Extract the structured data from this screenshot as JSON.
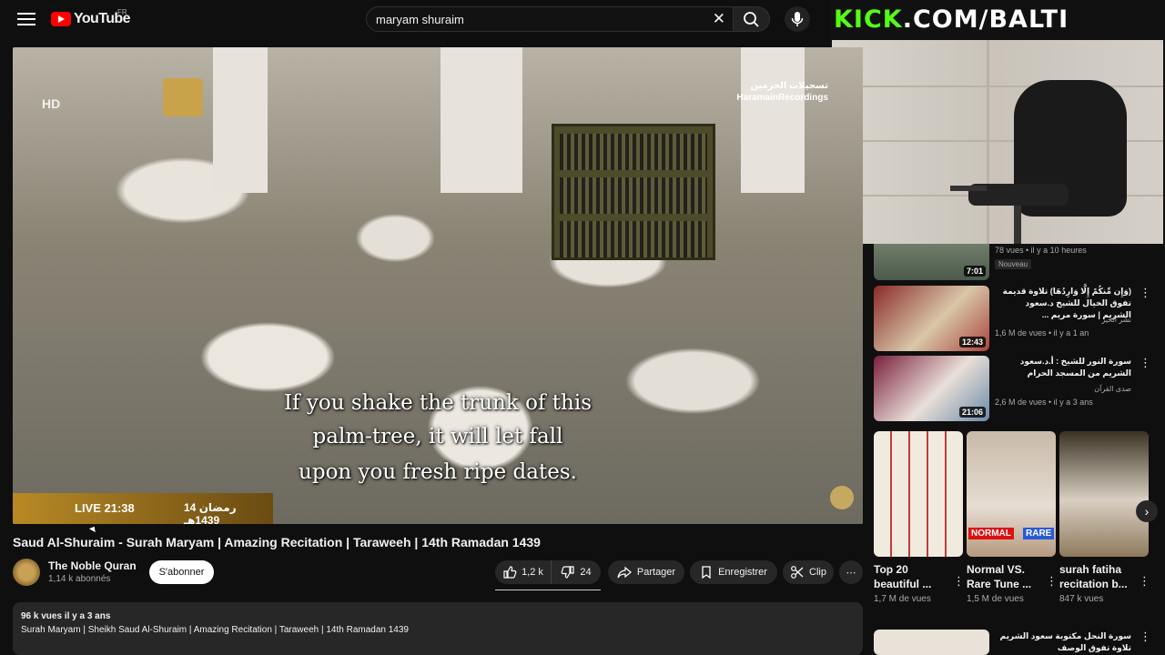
{
  "header": {
    "logo_text": "YouTube",
    "logo_region": "FR",
    "search_value": "maryam shuraim",
    "search_clear": "✕"
  },
  "overlay": {
    "kick_prefix": "KICK",
    "kick_suffix": ".COM/BALTI"
  },
  "video": {
    "channel_mark": "HD",
    "watermark_ar": "تسجيلات الحرمين",
    "watermark_en": "HaramainRecordings",
    "subtitle_lines": [
      "If you shake the trunk of this",
      "palm-tree, it will let fall",
      "upon you fresh ripe dates."
    ],
    "live_label": "LIVE 21:38",
    "live_date": "14 رمضان 1439هـ"
  },
  "watch": {
    "title": "Saud Al-Shuraim - Surah Maryam | Amazing Recitation | Taraweeh | 14th Ramadan 1439",
    "channel_name": "The Noble Quran",
    "subscribers": "1,14 k abonnés",
    "subscribe_label": "S'abonner",
    "likes": "1,2 k",
    "dislikes": "24",
    "share_label": "Partager",
    "save_label": "Enregistrer",
    "clip_label": "Clip",
    "more_label": "⋯"
  },
  "description": {
    "meta": "96 k vues  il y a 3 ans",
    "text": "Surah Maryam | Sheikh Saud Al-Shuraim | Amazing Recitation | Taraweeh | 14th Ramadan 1439"
  },
  "sidebar": {
    "recs": [
      {
        "duration": "7:01",
        "stats": "78 vues • il y a 10 heures",
        "badge": "Nouveau"
      },
      {
        "title": "(وَإِن مِّنكُمْ إِلَّا وَارِدُهَا) تلاوة قديمة تفوق الخيال للشيخ د.سعود الشريم | سورة مريم ...",
        "channel": "نشر الخير",
        "stats": "1,6 M de vues • il y a 1 an",
        "duration": "12:43"
      },
      {
        "title": "سورة النور للشيخ : أ.د.سعود الشريم من المسجد الحرام",
        "channel": "صدى القرآن",
        "stats": "2,6 M de vues • il y a 3 ans",
        "duration": "21:06"
      },
      {
        "title": "سورة النحل مكتوبة سعود الشريم تلاوة تفوق الوصف",
        "channel": ""
      }
    ],
    "shorts": [
      {
        "title": "Top 20 beautiful ...",
        "views": "1,7 M de vues"
      },
      {
        "title": "Normal VS. Rare Tune ...",
        "views": "1,5 M de vues",
        "label_normal": "NORMAL",
        "label_rare": "RARE"
      },
      {
        "title": "surah fatiha recitation b...",
        "views": "847 k vues"
      }
    ],
    "next_arrow": "›"
  },
  "colors": {
    "bg": "#0f0f0f",
    "pill": "#272727",
    "accent_red": "#ff0000",
    "kick_green": "#53fc18"
  }
}
